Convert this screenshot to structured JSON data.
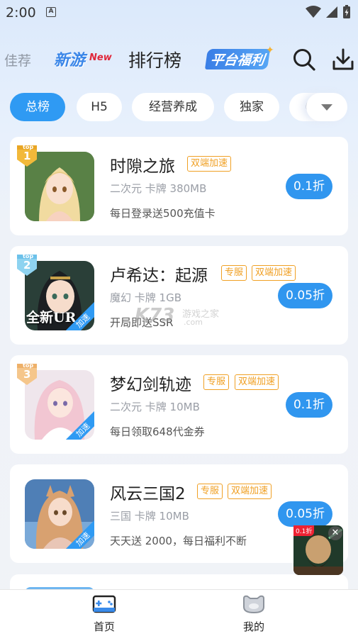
{
  "status": {
    "time": "2:00",
    "notif_icon": "A"
  },
  "nav": {
    "recommend": "佳荐",
    "new_games": "新游",
    "new_badge": "New",
    "ranking": "排行榜",
    "welfare": "平台福利"
  },
  "tabs": [
    "总榜",
    "H5",
    "经营养成",
    "独家",
    "("
  ],
  "games": [
    {
      "rank": "1",
      "rank_top": "top",
      "name": "时隙之旅",
      "tags": [
        "双端加速"
      ],
      "meta": "二次元 卡牌 380MB",
      "desc": "每日登录送500充值卡",
      "discount": "0.1折"
    },
    {
      "rank": "2",
      "rank_top": "top",
      "name": "卢希达：起源",
      "tags": [
        "专服",
        "双端加速"
      ],
      "meta": "魔幻 卡牌 1GB",
      "desc": "开局即送SSR",
      "discount": "0.05折",
      "icon_text": "全新UR",
      "icon_tag": "加速"
    },
    {
      "rank": "3",
      "rank_top": "top",
      "name": "梦幻剑轨迹",
      "tags": [
        "专服",
        "双端加速"
      ],
      "meta": "二次元 卡牌 10MB",
      "desc": "每日领取648代金券",
      "discount": "0.1折",
      "icon_tag": "加速"
    },
    {
      "rank": "",
      "rank_top": "",
      "name": "风云三国2",
      "tags": [
        "专服",
        "双端加速"
      ],
      "meta": "三国 卡牌 10MB",
      "desc": "天天送 2000，每日福利不断",
      "discount": "0.05折",
      "icon_tag": "加速"
    }
  ],
  "watermark": {
    "main": "K73",
    "sub": "游戏之家",
    "domain": ".com"
  },
  "floating_ad": {
    "tag": "0.1折"
  },
  "bottom_nav": {
    "home": "首页",
    "mine": "我的"
  },
  "colors": {
    "accent": "#2f9af3",
    "tag_orange": "#f0a024"
  }
}
